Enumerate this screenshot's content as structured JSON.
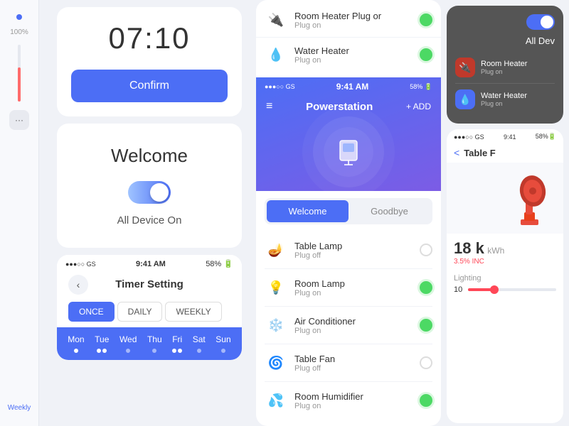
{
  "left_strip": {
    "percent_label": "100%",
    "weekly_label": "Weekly"
  },
  "top_card": {
    "time": "07:10",
    "confirm_label": "Confirm"
  },
  "welcome_card": {
    "title": "Welcome",
    "all_device_label": "All Device On"
  },
  "timer": {
    "title": "Timer Setting",
    "time": "9:41 AM",
    "battery": "58%",
    "signal": "●●●○○ GS",
    "freq_tabs": [
      "ONCE",
      "DAILY",
      "WEEKLY"
    ],
    "active_freq": "ONCE",
    "days": [
      {
        "label": "Mon",
        "dots": 1
      },
      {
        "label": "Tue",
        "dots": 2
      },
      {
        "label": "Wed",
        "dots": 1
      },
      {
        "label": "Thu",
        "dots": 1
      },
      {
        "label": "Fri",
        "dots": 2
      },
      {
        "label": "Sat",
        "dots": 1
      },
      {
        "label": "Sun",
        "dots": 0
      }
    ]
  },
  "middle_panel": {
    "statusbar": {
      "signal": "●●●○○ GS",
      "time": "9:41 AM",
      "battery": "58%"
    },
    "title": "Powerstation",
    "add_label": "+ ADD",
    "tabs": [
      {
        "label": "Welcome",
        "active": true
      },
      {
        "label": "Goodbye",
        "active": false
      }
    ],
    "top_devices": [
      {
        "name": "Room Heater Plug or",
        "status": "Plug on",
        "on": true,
        "icon": "🔌"
      },
      {
        "name": "Water Heater",
        "status": "Plug on",
        "on": true,
        "icon": "💧"
      }
    ],
    "devices": [
      {
        "name": "Table Lamp",
        "status": "Plug off",
        "on": false,
        "icon": "🪔"
      },
      {
        "name": "Room Lamp",
        "status": "Plug on",
        "on": true,
        "icon": "💡"
      },
      {
        "name": "Air Conditioner",
        "status": "Plug on",
        "on": true,
        "icon": "❄️"
      },
      {
        "name": "Table Fan",
        "status": "Plug off",
        "on": false,
        "icon": "🌀"
      },
      {
        "name": "Room Humidifier",
        "status": "Plug on",
        "on": true,
        "icon": "💦"
      }
    ]
  },
  "right_panel": {
    "all_dev_title": "All Dev",
    "statusbar": {
      "signal": "●●●○○ GS",
      "time": "9:41",
      "battery": "58%"
    },
    "popup_devices": [
      {
        "name": "Room Heater",
        "status": "Plug on",
        "icon": "🔌",
        "color": "#e74c3c"
      },
      {
        "name": "Water Heater",
        "status": "Plug on",
        "icon": "💧",
        "color": "#5b6ee1"
      }
    ],
    "detail": {
      "back_label": "<",
      "title": "Table F",
      "stat_value": "18 k",
      "stat_unit": "kWh",
      "stat_change": "3.5% INC",
      "lighting_label": "Lighting",
      "lighting_value": "10",
      "slider_pct": 30
    }
  }
}
